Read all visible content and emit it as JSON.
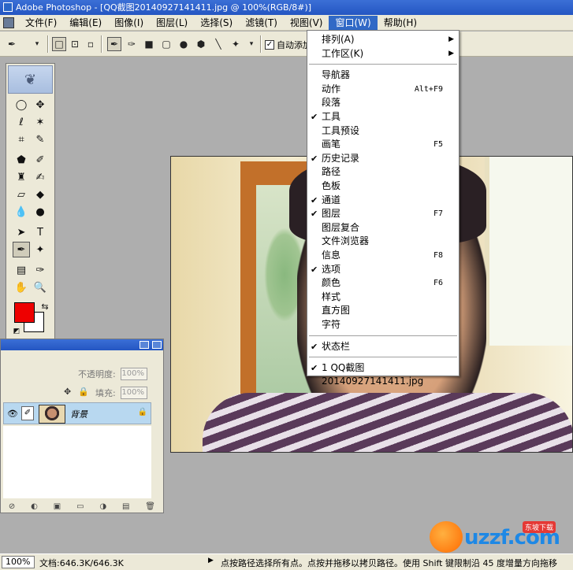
{
  "app": {
    "title": "Adobe Photoshop - [QQ截图20140927141411.jpg @ 100%(RGB/8#)]"
  },
  "menubar": {
    "items": [
      "文件(F)",
      "编辑(E)",
      "图像(I)",
      "图层(L)",
      "选择(S)",
      "滤镜(T)",
      "视图(V)",
      "窗口(W)",
      "帮助(H)"
    ],
    "active_index": 7
  },
  "options_bar": {
    "auto_add_label": "自动添加",
    "auto_add_checked": true
  },
  "window_menu": {
    "items": [
      {
        "label": "排列(A)",
        "submenu": true
      },
      {
        "label": "工作区(K)",
        "submenu": true
      },
      {
        "separator": true
      },
      {
        "label": "导航器"
      },
      {
        "label": "动作",
        "shortcut": "Alt+F9"
      },
      {
        "label": "段落"
      },
      {
        "label": "工具",
        "checked": true
      },
      {
        "label": "工具预设"
      },
      {
        "label": "画笔",
        "shortcut": "F5"
      },
      {
        "label": "历史记录",
        "checked": true
      },
      {
        "label": "路径"
      },
      {
        "label": "色板"
      },
      {
        "label": "通道",
        "checked": true
      },
      {
        "label": "图层",
        "checked": true,
        "shortcut": "F7"
      },
      {
        "label": "图层复合"
      },
      {
        "label": "文件浏览器"
      },
      {
        "label": "信息",
        "shortcut": "F8"
      },
      {
        "label": "选项",
        "checked": true
      },
      {
        "label": "颜色",
        "shortcut": "F6"
      },
      {
        "label": "样式"
      },
      {
        "label": "直方图"
      },
      {
        "label": "字符"
      },
      {
        "separator": true
      },
      {
        "label": "状态栏",
        "checked": true
      },
      {
        "separator": true
      },
      {
        "label": "1 QQ截图20140927141411.jpg",
        "checked": true
      }
    ]
  },
  "toolbox": {
    "foreground_color": "#ee0000",
    "background_color": "#ffffff"
  },
  "layers_palette": {
    "opacity_label": "不透明度:",
    "opacity_value": "100%",
    "fill_label": "填充:",
    "fill_value": "100%",
    "layer_name": "背景"
  },
  "statusbar": {
    "zoom": "100%",
    "doc_size": "文档:646.3K/646.3K",
    "hint": "点按路径选择所有点。点按并拖移以拷贝路径。使用 Shift 键限制沿 45 度增量方向拖移"
  },
  "watermark": {
    "brand": "uzzf.com",
    "tagline": "东坡下载"
  }
}
